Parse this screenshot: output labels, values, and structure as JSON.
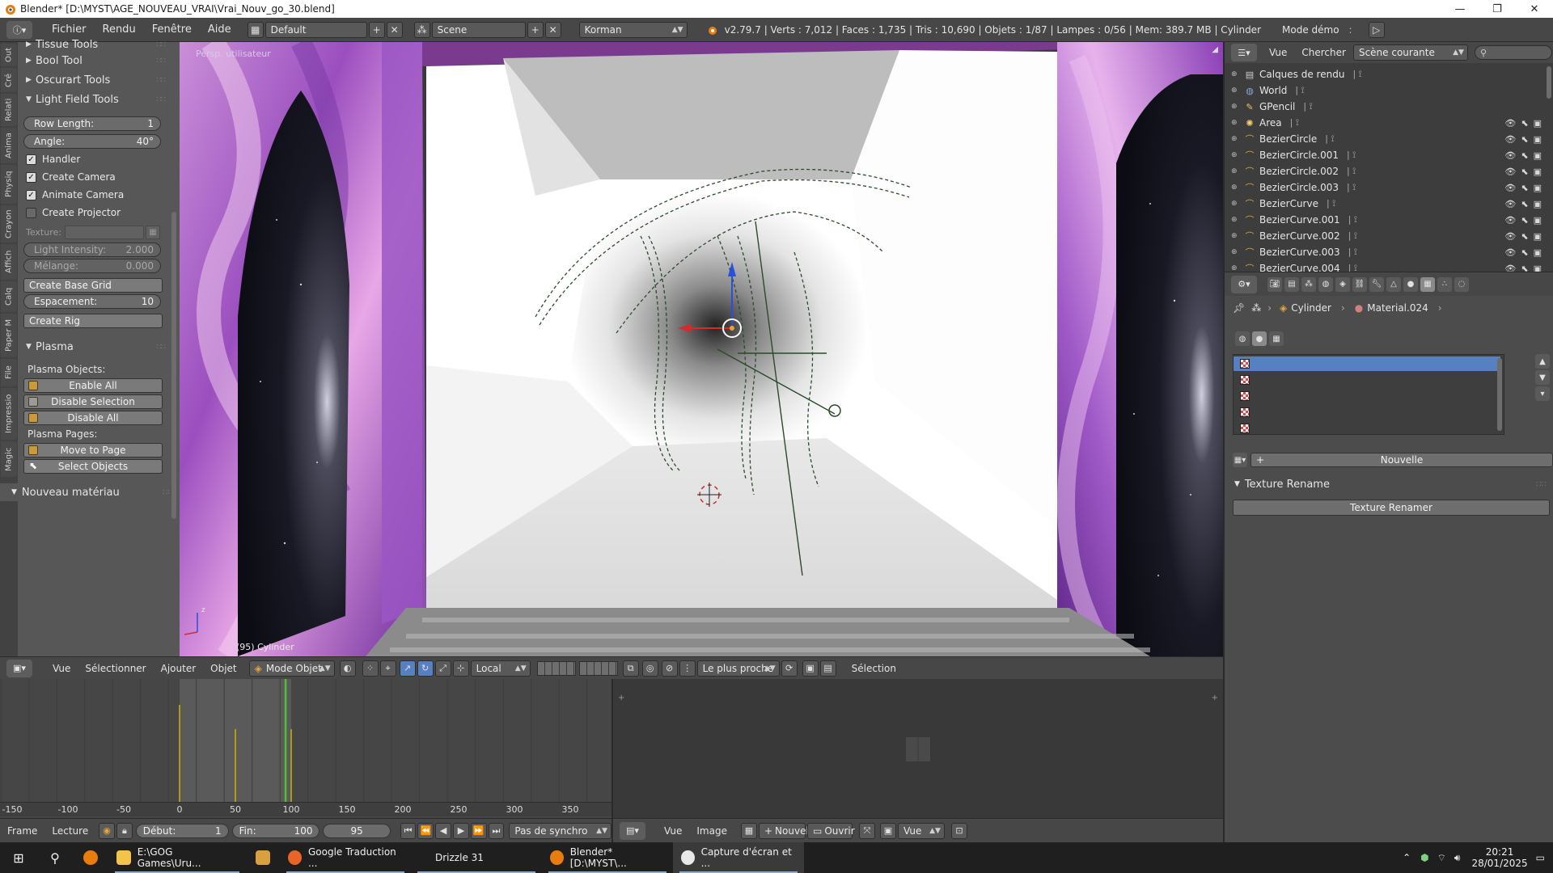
{
  "window": {
    "title": "Blender* [D:\\MYST\\AGE_NOUVEAU_VRAI\\Vrai_Nouv_go_30.blend]",
    "minimize_icon": "minimize-icon",
    "restore_icon": "restore-icon",
    "close_icon": "close-icon"
  },
  "info_header": {
    "menus": [
      "Fichier",
      "Rendu",
      "Fenêtre",
      "Aide"
    ],
    "screen_layout": "Default",
    "scene": "Scene",
    "render_engine": "Korman",
    "stats": "v2.79.7 | Verts : 7,012 | Faces : 1,735 | Tris : 10,690 | Objets : 1/87 | Lampes : 0/56 | Mem: 389.7 MB | Cylinder",
    "mode_demo": "Mode démo"
  },
  "tool_tabs": [
    "Out",
    "Cré",
    "Relati",
    "Anima",
    "Physiq",
    "Crayon",
    "Affich",
    "Calq",
    "Paper M",
    "File",
    "Impressio",
    "Magic"
  ],
  "tool_shelf": {
    "panels_collapsed": [
      "Tissue Tools",
      "Bool Tool",
      "Oscurart Tools"
    ],
    "light_field": {
      "title": "Light Field Tools",
      "row_length_label": "Row Length:",
      "row_length_value": "1",
      "angle_label": "Angle:",
      "angle_value": "40°",
      "handler": "Handler",
      "create_camera": "Create Camera",
      "animate_camera": "Animate Camera",
      "create_projector": "Create Projector",
      "texture_label": "Texture:",
      "light_intensity_label": "Light Intensity:",
      "light_intensity_value": "2.000",
      "melange_label": "Mélange:",
      "melange_value": "0.000",
      "create_base_grid": "Create Base Grid",
      "espacement_label": "Espacement:",
      "espacement_value": "10",
      "create_rig": "Create Rig"
    },
    "plasma": {
      "title": "Plasma",
      "objects_label": "Plasma Objects:",
      "enable_all": "Enable All",
      "disable_selection": "Disable Selection",
      "disable_all": "Disable All",
      "pages_label": "Plasma Pages:",
      "move_to_page": "Move to Page",
      "select_objects": "Select Objects"
    },
    "nouveau_materiau": "Nouveau matériau"
  },
  "viewport": {
    "view_name": "Persp. utilisateur",
    "object_label": "(95) Cylinder",
    "axis_z": "z"
  },
  "view3d_header": {
    "menus": [
      "Vue",
      "Sélectionner",
      "Ajouter",
      "Objet"
    ],
    "mode": "Mode Objet",
    "orientation": "Local",
    "snap": "Le plus proche",
    "selection": "Sélection"
  },
  "timeline": {
    "ticks": [
      "-150",
      "-100",
      "-50",
      "0",
      "50",
      "100",
      "150",
      "200",
      "250",
      "300",
      "350"
    ],
    "current_frame": 95
  },
  "timeline_header": {
    "menus": [
      "Frame",
      "Lecture"
    ],
    "start_label": "Début:",
    "start_value": "1",
    "end_label": "Fin:",
    "end_value": "100",
    "current": "95",
    "sync": "Pas de synchro"
  },
  "image_header": {
    "menus": [
      "Vue",
      "Image"
    ],
    "new_label": "Nouvel",
    "open_label": "Ouvrir",
    "view_label": "Vue"
  },
  "outliner_header": {
    "view": "Vue",
    "search": "Chercher",
    "display": "Scène courante"
  },
  "outliner": {
    "rows": [
      {
        "name": "Calques de rendu",
        "icon": "render-layers-icon"
      },
      {
        "name": "World",
        "icon": "world-icon"
      },
      {
        "name": "GPencil",
        "icon": "gpencil-icon"
      },
      {
        "name": "Area",
        "icon": "lamp-icon"
      },
      {
        "name": "BezierCircle",
        "icon": "curve-icon"
      },
      {
        "name": "BezierCircle.001",
        "icon": "curve-icon"
      },
      {
        "name": "BezierCircle.002",
        "icon": "curve-icon"
      },
      {
        "name": "BezierCircle.003",
        "icon": "curve-icon"
      },
      {
        "name": "BezierCurve",
        "icon": "curve-icon"
      },
      {
        "name": "BezierCurve.001",
        "icon": "curve-icon"
      },
      {
        "name": "BezierCurve.002",
        "icon": "curve-icon"
      },
      {
        "name": "BezierCurve.003",
        "icon": "curve-icon"
      },
      {
        "name": "BezierCurve.004",
        "icon": "curve-icon"
      }
    ]
  },
  "properties": {
    "object": "Cylinder",
    "material": "Material.024",
    "new_button": "Nouvelle",
    "texture_rename_title": "Texture Rename",
    "texture_renamer_button": "Texture Renamer"
  },
  "taskbar": {
    "items": [
      "E:\\GOG Games\\Uru...",
      "Google Traduction ...",
      "Drizzle 31",
      "Blender* [D:\\MYST\\...",
      "Capture d'écran et ..."
    ],
    "time": "20:21",
    "date": "28/01/2025"
  },
  "colors": {
    "accent": "#5680c2",
    "panel": "#575757",
    "header": "#474747"
  }
}
